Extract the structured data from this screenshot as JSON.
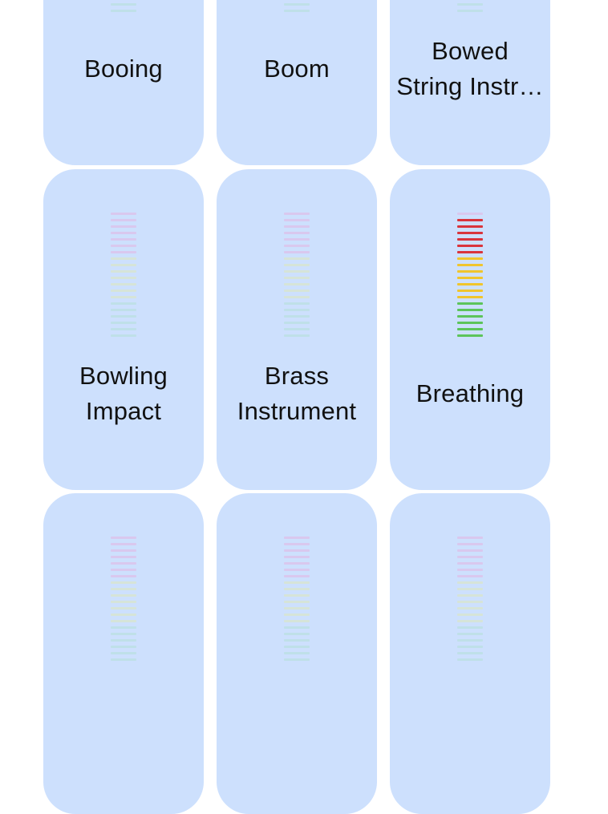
{
  "colors": {
    "card_background": "#cde0fd",
    "meter_red_active": "#d9343c",
    "meter_yellow_active": "#f0c52c",
    "meter_green_active": "#5cc45a",
    "meter_red_inactive": "#d9c8ee",
    "meter_yellow_inactive": "#d6e4d8",
    "meter_green_inactive": "#bfe0e8"
  },
  "sounds": [
    {
      "label": "Booing",
      "level": 0
    },
    {
      "label": "Boom",
      "level": 0
    },
    {
      "label": "Bowed\nString Instr…",
      "level": 0
    },
    {
      "label": "Bowling\nImpact",
      "level": 0
    },
    {
      "label": "Brass\nInstrument",
      "level": 0
    },
    {
      "label": "Breathing",
      "level": 0.95
    },
    {
      "label": "",
      "level": 0
    },
    {
      "label": "",
      "level": 0
    },
    {
      "label": "",
      "level": 0
    }
  ]
}
